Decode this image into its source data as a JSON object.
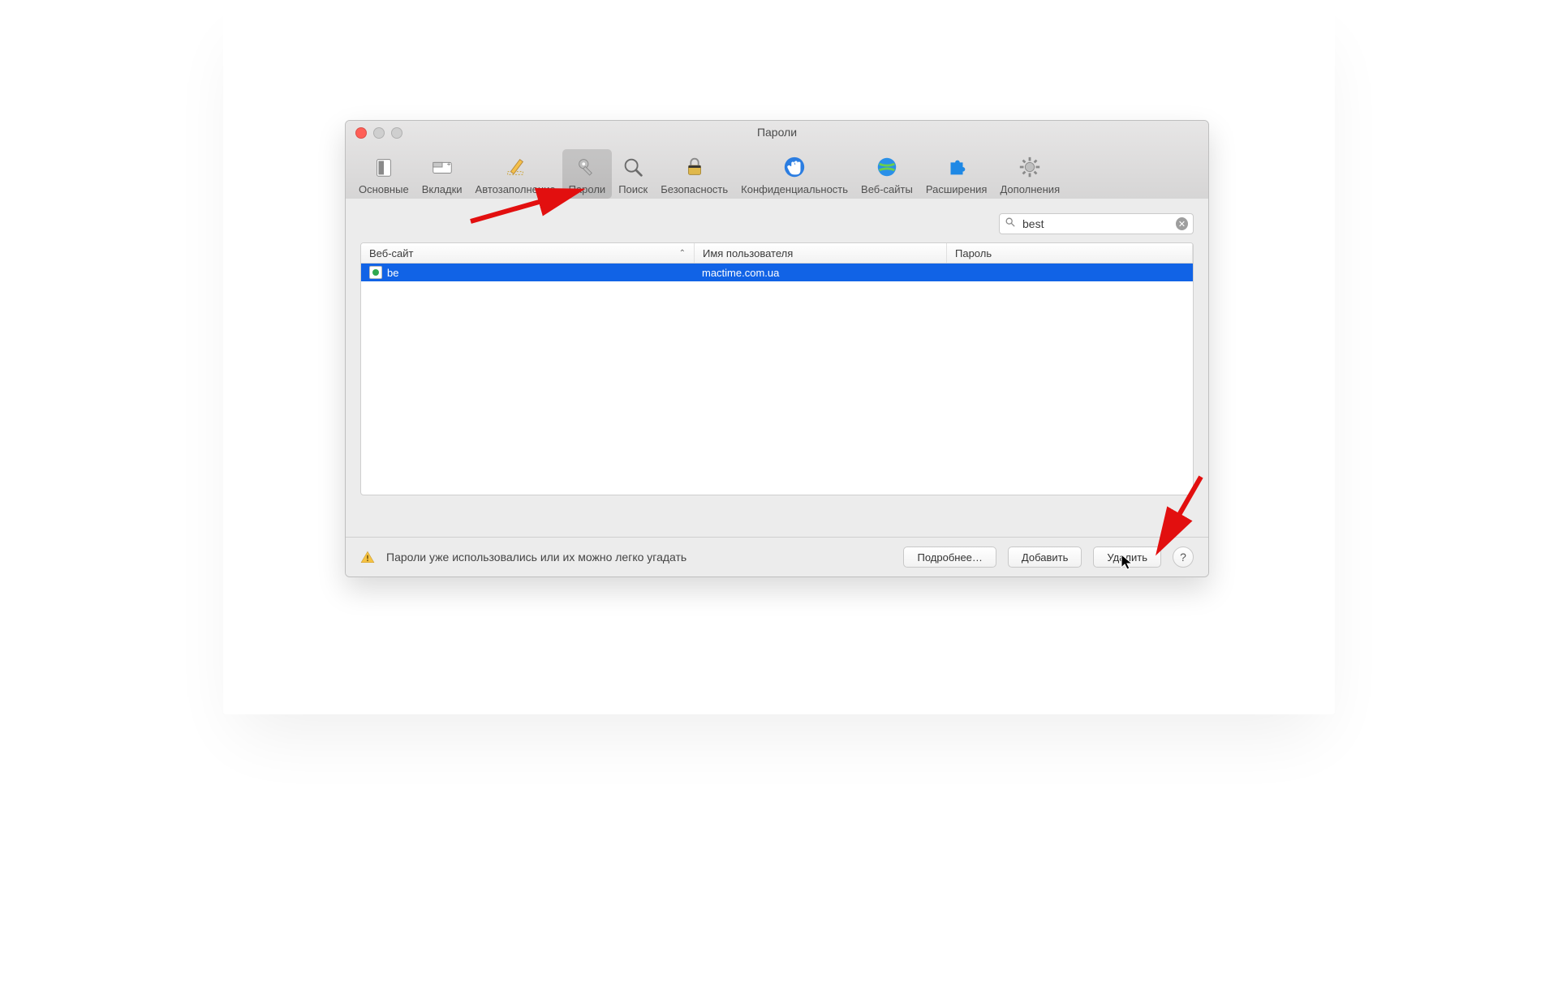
{
  "window": {
    "title": "Пароли"
  },
  "toolbar": {
    "items": [
      {
        "id": "general",
        "label": "Основные"
      },
      {
        "id": "tabs",
        "label": "Вкладки"
      },
      {
        "id": "autofill",
        "label": "Автозаполнение"
      },
      {
        "id": "passwords",
        "label": "Пароли",
        "active": true
      },
      {
        "id": "search",
        "label": "Поиск"
      },
      {
        "id": "security",
        "label": "Безопасность"
      },
      {
        "id": "privacy",
        "label": "Конфиденциальность"
      },
      {
        "id": "websites",
        "label": "Веб-сайты"
      },
      {
        "id": "extensions",
        "label": "Расширения"
      },
      {
        "id": "advanced",
        "label": "Дополнения"
      }
    ]
  },
  "search": {
    "value": "best"
  },
  "table": {
    "columns": {
      "website": "Веб-сайт",
      "username": "Имя пользователя",
      "password": "Пароль"
    },
    "rows": [
      {
        "website": "be",
        "username": "mactime.com.ua",
        "password": "",
        "selected": true
      }
    ]
  },
  "footer": {
    "warning": "Пароли уже использовались или их можно легко угадать",
    "details": "Подробнее…",
    "add": "Добавить",
    "remove": "Удалить",
    "help": "?"
  }
}
